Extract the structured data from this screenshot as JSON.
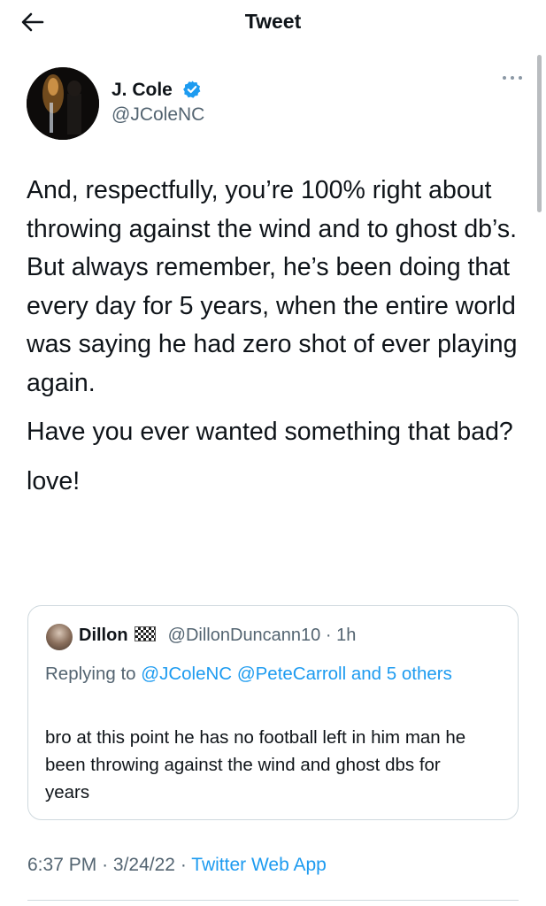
{
  "header": {
    "title": "Tweet",
    "back_icon": "arrow-left-icon"
  },
  "tweet": {
    "author_name": "J. Cole",
    "author_handle": "@JColeNC",
    "verified": true,
    "paragraphs": [
      "And, respectfully, you’re 100% right about throwing against the wind and to ghost db’s. But always remember, he’s been doing that every day for 5 years, when the entire world was saying he had zero shot of ever playing again.",
      "Have you ever wanted something that bad?",
      "love!"
    ],
    "time": "6:37 PM",
    "date": "3/24/22",
    "source": "Twitter Web App",
    "separator": "·"
  },
  "quote": {
    "name": "Dillon",
    "handle": "@DillonDuncann10",
    "separator": "·",
    "age": "1h",
    "replying_prefix": "Replying to",
    "mention_1": "@JColeNC",
    "mention_2": "@PeteCarroll",
    "replying_and": "and",
    "replying_others": "5 others",
    "text": "bro at this point he has no football left in him man he been throwing against the wind and ghost dbs for years"
  },
  "colors": {
    "accent": "#1d9bf0",
    "text": "#0f1419",
    "muted": "#536471",
    "border": "#cfd9de"
  }
}
